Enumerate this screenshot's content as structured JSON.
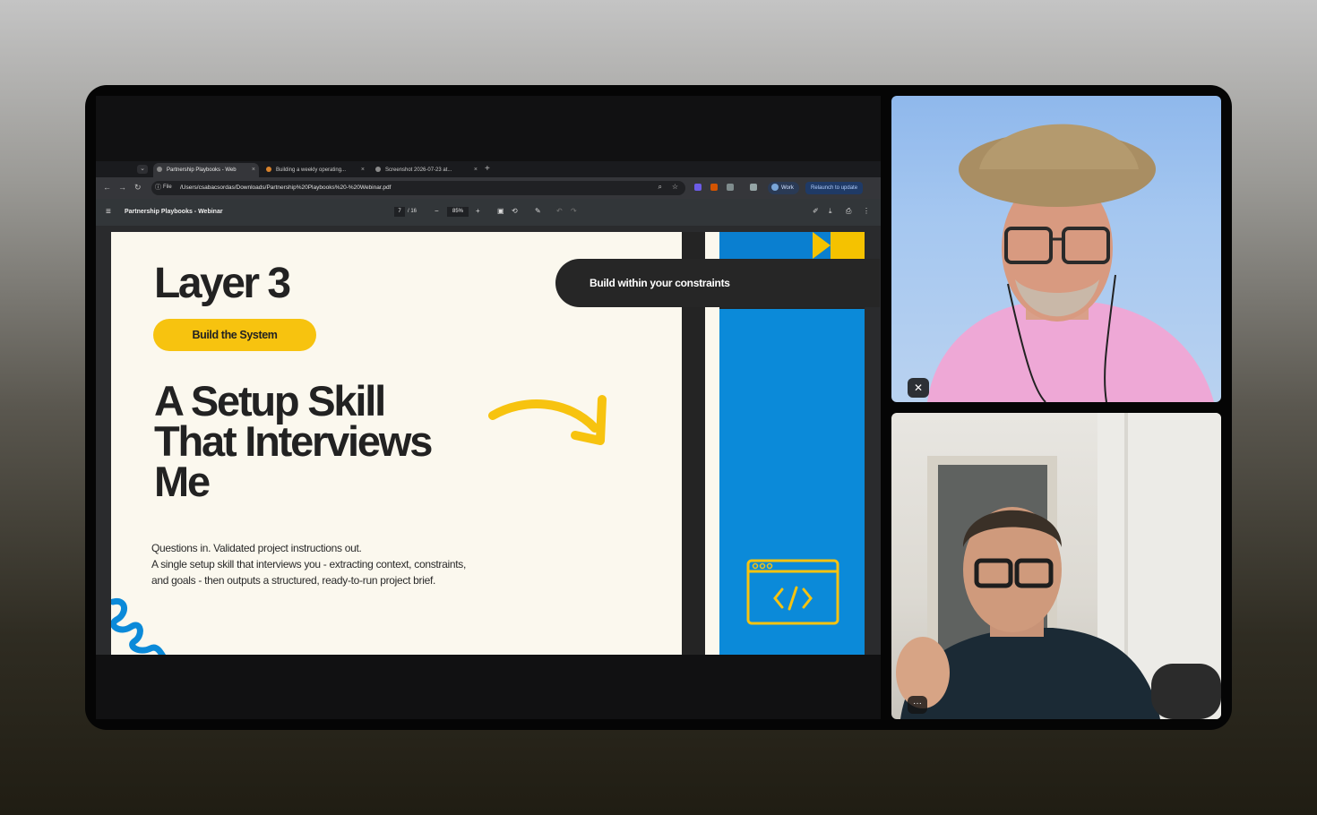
{
  "browser": {
    "tabs": [
      {
        "label": "Partnership Playbooks - Web"
      },
      {
        "label": "Building a weekly operating..."
      },
      {
        "label": "Screenshot 2026-07-23 at..."
      }
    ],
    "tab_close": "×",
    "new_tab": "+",
    "url_scheme": "File",
    "url": "/Users/csabacsordas/Downloads/Partnership%20Playbooks%20-%20Webinar.pdf",
    "profile_label": "Work",
    "relaunch_label": "Relaunch to update"
  },
  "pdf_toolbar": {
    "title": "Partnership Playbooks - Webinar",
    "page_current": "7",
    "page_total": "/ 16",
    "zoom": "85%"
  },
  "slide": {
    "layer_title": "Layer 3",
    "layer_button": "Build the System",
    "headline_lines": [
      "A Setup Skill",
      "That Interviews",
      "Me"
    ],
    "body_lines": [
      "Questions in. Validated project instructions out.",
      "A single setup skill that interviews you - extracting context, constraints,",
      "and goals - then outputs a structured, ready-to-run project brief."
    ],
    "pill_text": "Build within your constraints",
    "colors": {
      "yellow": "#f7c30f",
      "blue": "#0b8ad9",
      "dark": "#262626",
      "paper": "#fbf8ee"
    }
  },
  "participants": [
    {
      "status_icon": "mic-muted-icon",
      "control": "✕"
    },
    {
      "status_icon": "more-options-icon",
      "control": "···"
    }
  ]
}
